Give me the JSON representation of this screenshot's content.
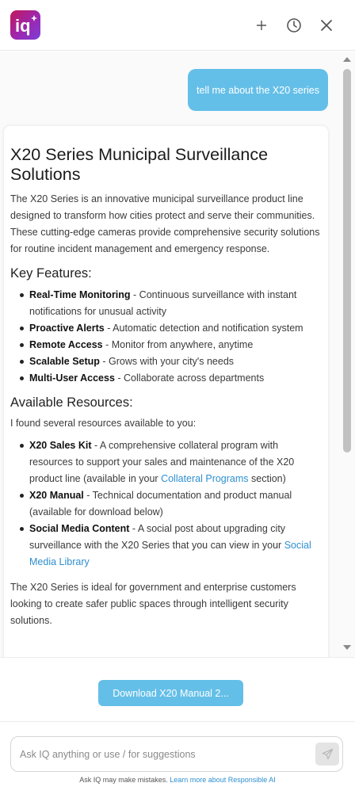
{
  "header": {
    "logo_text": "iq",
    "icons": [
      "plus-icon",
      "history-icon",
      "close-icon"
    ]
  },
  "conversation": {
    "user_message": "tell me about the X20 series",
    "answer": {
      "title": "X20 Series Municipal Surveillance Solutions",
      "intro": "The X20 Series is an innovative municipal surveillance product line designed to transform how cities protect and serve their communities. These cutting-edge cameras provide comprehensive security solutions for routine incident management and emergency response.",
      "features_heading": "Key Features:",
      "features": [
        {
          "name": "Real-Time Monitoring",
          "desc": " - Continuous surveillance with instant notifications for unusual activity"
        },
        {
          "name": "Proactive Alerts",
          "desc": " - Automatic detection and notification system"
        },
        {
          "name": "Remote Access",
          "desc": " - Monitor from anywhere, anytime"
        },
        {
          "name": "Scalable Setup",
          "desc": " - Grows with your city's needs"
        },
        {
          "name": "Multi-User Access",
          "desc": " - Collaborate across departments"
        }
      ],
      "resources_heading": "Available Resources:",
      "resources_intro": "I found several resources available to you:",
      "resources": [
        {
          "name": "X20 Sales Kit",
          "desc_before": " - A comprehensive collateral program with resources to support your sales and maintenance of the X20 product line (available in your ",
          "link": "Collateral Programs",
          "desc_after": " section)"
        },
        {
          "name": "X20 Manual",
          "desc_before": " - Technical documentation and product manual (available for download below)",
          "link": "",
          "desc_after": ""
        },
        {
          "name": "Social Media Content",
          "desc_before": " - A social post about upgrading city surveillance with the X20 Series that you can view in your ",
          "link": "Social Media Library",
          "desc_after": ""
        }
      ],
      "closing": "The X20 Series is ideal for government and enterprise customers looking to create safer public spaces through intelligent security solutions."
    }
  },
  "download_button": "Download X20 Manual 2...",
  "input": {
    "placeholder": "Ask IQ anything or use / for suggestions",
    "value": ""
  },
  "disclaimer": {
    "text": "Ask IQ may make mistakes. ",
    "link": "Learn more about Responsible AI"
  },
  "colors": {
    "accent": "#64bfe8",
    "link": "#2e8fd0",
    "logo_gradient_start": "#c2185b",
    "logo_gradient_end": "#7b3fd6"
  }
}
